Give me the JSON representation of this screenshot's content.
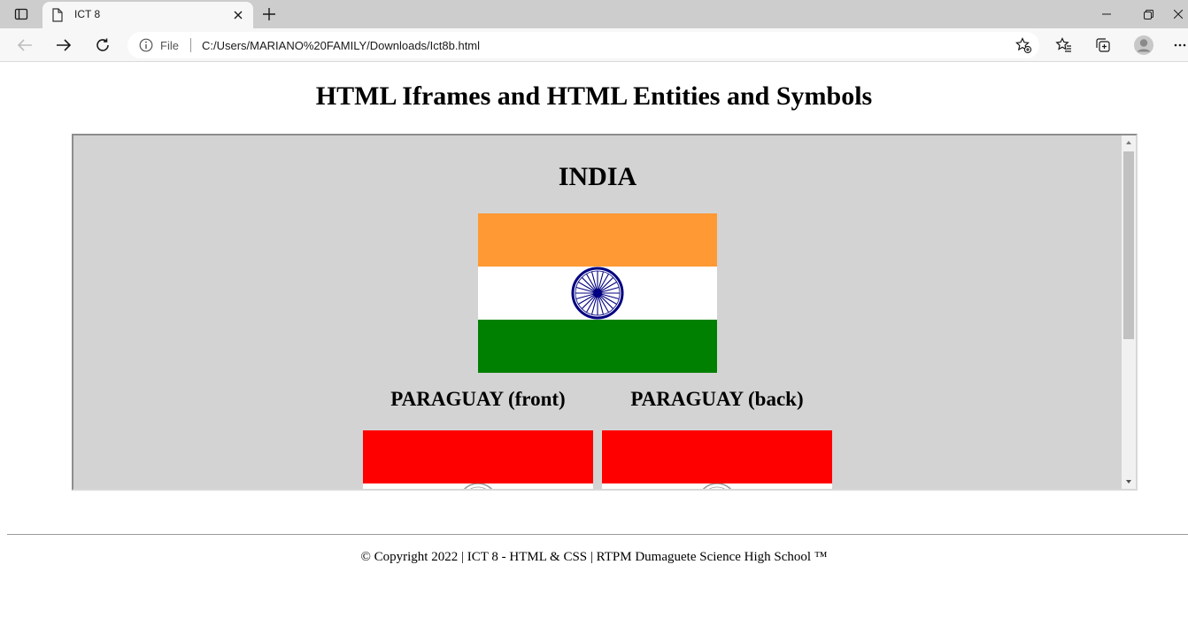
{
  "browser": {
    "tab_title": "ICT 8",
    "address_prefix": "File",
    "url": "C:/Users/MARIANO%20FAMILY/Downloads/Ict8b.html",
    "icons": [
      "sidebar-icon",
      "document-icon",
      "close-icon",
      "plus-icon",
      "minimize-icon",
      "restore-icon",
      "close-icon",
      "back-arrow-icon",
      "forward-arrow-icon",
      "reload-icon",
      "info-icon",
      "favorite-add-icon",
      "favorites-icon",
      "collections-icon",
      "profile-avatar-icon",
      "more-icon"
    ]
  },
  "page": {
    "title": "HTML Iframes and HTML Entities and Symbols",
    "iframe": {
      "country_title": "INDIA",
      "flag_left_heading": "PARAGUAY (front)",
      "flag_right_heading": "PARAGUAY (back)"
    },
    "footer": "© Copyright 2022 | ICT 8 - HTML & CSS | RTPM Dumaguete Science High School ™"
  },
  "colors": {
    "india_saffron": "#FF9933",
    "india_green": "#138808",
    "chakra_blue": "#000080",
    "paraguay_red": "#FF0000",
    "iframe_bg": "#D3D3D3"
  }
}
